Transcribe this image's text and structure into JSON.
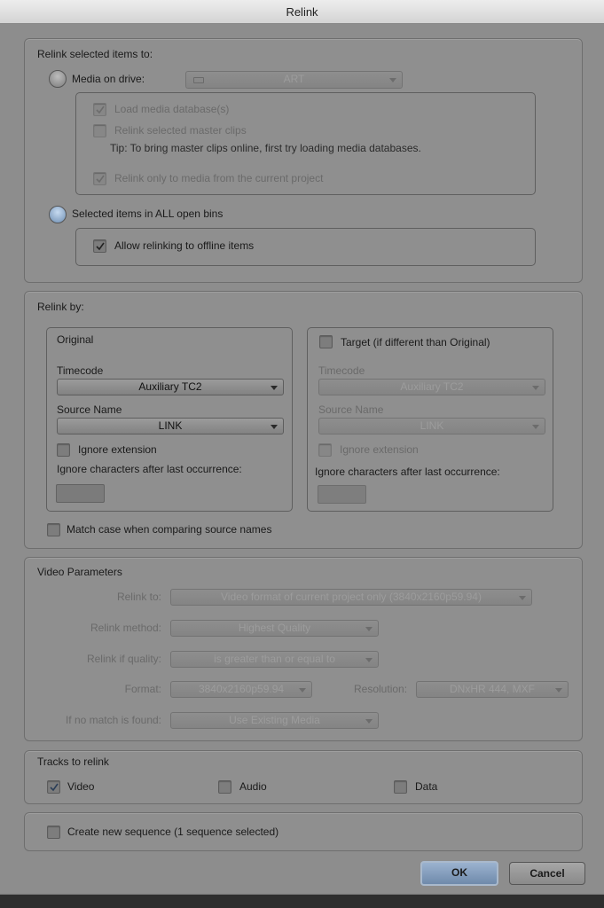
{
  "window": {
    "title": "Relink"
  },
  "relink_to": {
    "heading": "Relink selected items to:",
    "media_on_drive": {
      "label": "Media on drive:",
      "selected": false,
      "drive_value": "ART"
    },
    "load_media_db": {
      "label": "Load media database(s)",
      "checked": true
    },
    "relink_master_clips": {
      "label": "Relink selected master clips",
      "checked": false
    },
    "tip": "Tip: To bring master clips online, first try loading media databases.",
    "relink_current_project": {
      "label": "Relink only to media from the current project",
      "checked": true
    },
    "all_open_bins": {
      "label": "Selected items in ALL open bins",
      "selected": true
    },
    "allow_offline": {
      "label": "Allow relinking to offline items",
      "checked": true
    }
  },
  "relink_by": {
    "heading": "Relink by:",
    "original": {
      "title": "Original",
      "timecode_label": "Timecode",
      "timecode_value": "Auxiliary TC2",
      "source_name_label": "Source Name",
      "source_name_value": "LINK",
      "ignore_extension": "Ignore extension",
      "ignore_chars": "Ignore characters after last occurrence:"
    },
    "target": {
      "title": "Target (if different than Original)",
      "timecode_label": "Timecode",
      "timecode_value": "Auxiliary TC2",
      "source_name_label": "Source Name",
      "source_name_value": "LINK",
      "ignore_extension": "Ignore extension",
      "ignore_chars": "Ignore characters after last occurrence:"
    },
    "match_case": "Match case when comparing source names"
  },
  "video_params": {
    "heading": "Video Parameters",
    "relink_to_label": "Relink to:",
    "relink_to_value": "Video format of current project only (3840x2160p59.94)",
    "method_label": "Relink method:",
    "method_value": "Highest Quality",
    "quality_label": "Relink if quality:",
    "quality_value": "is greater than or equal to",
    "format_label": "Format:",
    "format_value": "3840x2160p59.94",
    "resolution_label": "Resolution:",
    "resolution_value": "DNxHR 444, MXF",
    "no_match_label": "If no match is found:",
    "no_match_value": "Use Existing Media"
  },
  "tracks": {
    "heading": "Tracks to relink",
    "video": "Video",
    "audio": "Audio",
    "data": "Data"
  },
  "create_sequence": "Create new sequence  (1 sequence selected)",
  "buttons": {
    "ok": "OK",
    "cancel": "Cancel"
  },
  "colors": {
    "dialog_bg": "#8d8d8d",
    "accent_blue": "#7f9dc0"
  }
}
